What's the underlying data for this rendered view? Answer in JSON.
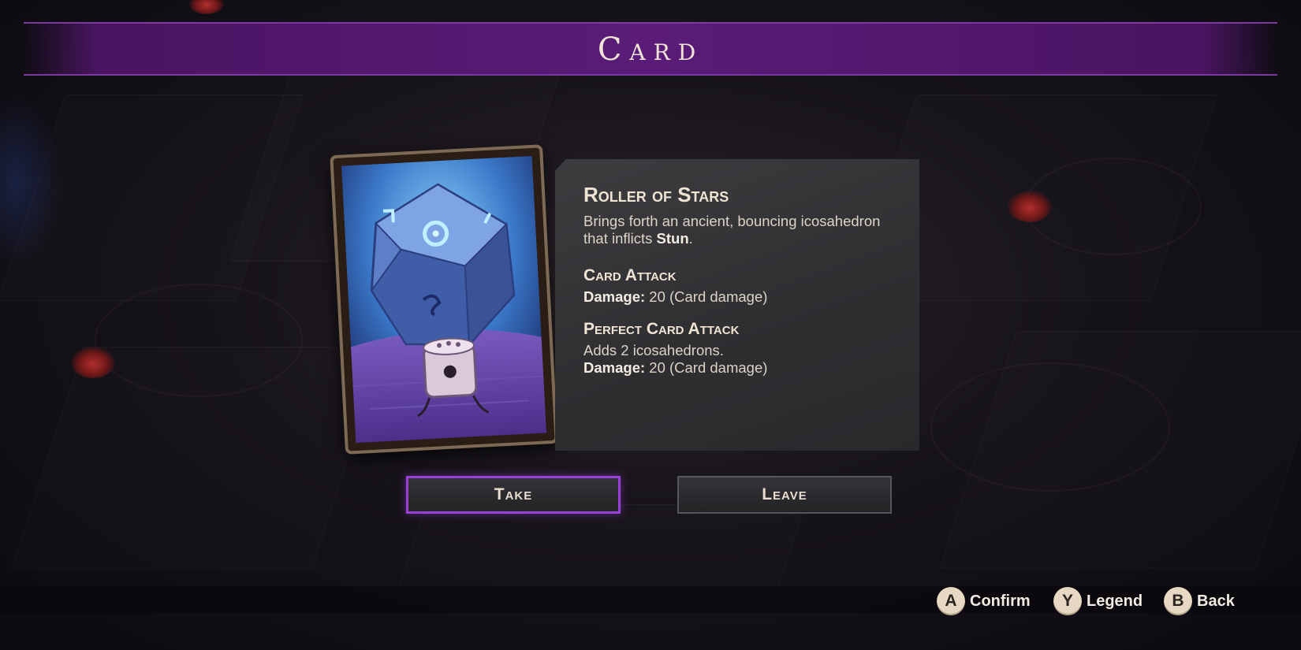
{
  "screen": {
    "title": "Card"
  },
  "card": {
    "name": "Roller of Stars",
    "description_prefix": "Brings forth an ancient, bouncing icosahedron that inflicts ",
    "description_keyword": "Stun",
    "description_suffix": ".",
    "sections": [
      {
        "title": "Card Attack",
        "lines": [
          {
            "label": "Damage:",
            "value": " 20 (Card damage)"
          }
        ]
      },
      {
        "title": "Perfect Card Attack",
        "lines": [
          {
            "text": "Adds 2 icosahedrons."
          },
          {
            "label": "Damage:",
            "value": " 20 (Card damage)"
          }
        ]
      }
    ]
  },
  "actions": {
    "take_label": "Take",
    "leave_label": "Leave"
  },
  "hints": [
    {
      "key": "A",
      "label": "Confirm",
      "icon": "a-button-icon"
    },
    {
      "key": "Y",
      "label": "Legend",
      "icon": "y-button-icon"
    },
    {
      "key": "B",
      "label": "Back",
      "icon": "b-button-icon"
    }
  ],
  "colors": {
    "banner": "#5a1c78",
    "selected_outline": "#9a3fd8",
    "panel": "#333336"
  }
}
